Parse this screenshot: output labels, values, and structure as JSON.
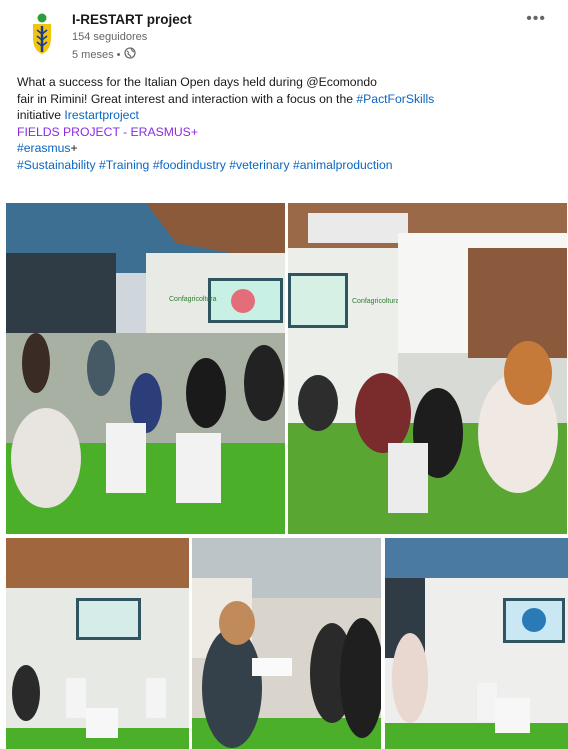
{
  "post": {
    "author": "I-RESTART project",
    "followers": "154 seguidores",
    "time": "5 meses •",
    "more_icon": "more-dots-icon",
    "globe_icon": "globe-icon"
  },
  "text": {
    "line1": "What a success for the Italian Open days held during @Ecomondo",
    "line2_pre": " fair in Rimini! Great interest and interaction with a focus on the ",
    "line2_tag": "#PactForSkills",
    "line3_pre": "initiative ",
    "line3_tag": "Irestartproject",
    "line4": "FIELDS PROJECT - ERASMUS+",
    "line5_tag": "#erasmus",
    "line5_post": "+",
    "line6": "#Sustainability #Training #foodindustry #veterinary #animalproduction"
  },
  "photos": {
    "screen_label": "Confagricoltura",
    "banner_label": "Confagricoltura"
  },
  "colors": {
    "link": "#0a66c2",
    "accent_purple": "#8a2be2",
    "floor_green": "#4caf2a"
  }
}
